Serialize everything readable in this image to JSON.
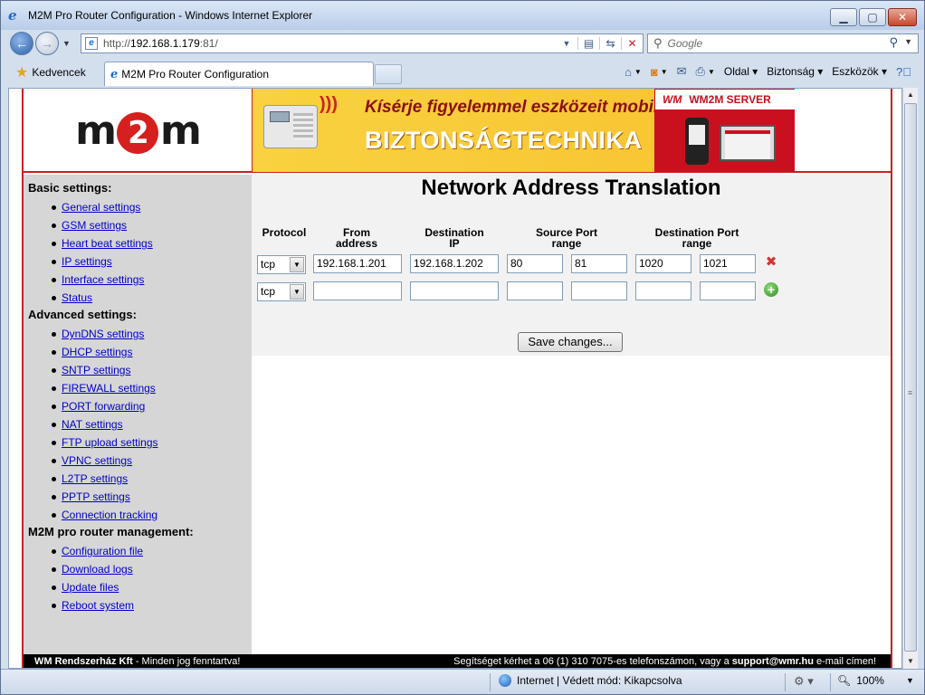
{
  "window": {
    "title": "M2M Pro Router Configuration - Windows Internet Explorer",
    "min_label": "▁",
    "max_label": "▢",
    "close_label": "✕"
  },
  "nav": {
    "url_prefix": "http://",
    "url_host": "192.168.1.179",
    "url_suffix": ":81/",
    "search_placeholder": "Google"
  },
  "favbar": {
    "favorites_label": "Kedvencek",
    "tab_title": "M2M Pro Router Configuration",
    "page_menu": "Oldal",
    "safety_menu": "Biztonság",
    "tools_menu": "Eszközök"
  },
  "banner": {
    "slogan": "Kísérje figyelemmel eszközeit mobilon!",
    "headline": "BIZTONSÁGTECHNIKA",
    "wm_logo": "WM",
    "wm_server": "WM2M SERVER"
  },
  "sidebar": {
    "basic_title": "Basic settings:",
    "basic_items": [
      "General settings",
      "GSM settings",
      "Heart beat settings",
      "IP settings",
      "Interface settings",
      "Status"
    ],
    "advanced_title": "Advanced settings:",
    "advanced_items": [
      "DynDNS settings",
      "DHCP settings",
      "SNTP settings",
      "FIREWALL settings",
      "PORT forwarding",
      "NAT settings",
      "FTP upload settings",
      "VPNC settings",
      "L2TP settings",
      "PPTP settings",
      "Connection tracking"
    ],
    "mgmt_title": "M2M pro router management:",
    "mgmt_items": [
      "Configuration file",
      "Download logs",
      "Update files",
      "Reboot system"
    ]
  },
  "main": {
    "heading": "Network Address Translation",
    "headers": {
      "protocol": "Protocol",
      "from_1": "From",
      "from_2": "address",
      "dest_1": "Destination",
      "dest_2": "IP",
      "sport_1": "Source Port",
      "sport_2": "range",
      "dport_1": "Destination Port",
      "dport_2": "range"
    },
    "rows": [
      {
        "protocol": "tcp",
        "from": "192.168.1.201",
        "dest": "192.168.1.202",
        "sp_from": "80",
        "sp_to": "81",
        "dp_from": "1020",
        "dp_to": "1021"
      },
      {
        "protocol": "tcp",
        "from": "",
        "dest": "",
        "sp_from": "",
        "sp_to": "",
        "dp_from": "",
        "dp_to": ""
      }
    ],
    "save_label": "Save changes..."
  },
  "footer": {
    "company": "WM Rendszerház Kft",
    "rights": " - Minden jog fenntartva!",
    "help_text": "Segítséget kérhet a 06 (1) 310 7075-es telefonszámon, vagy a ",
    "email": "support@wmr.hu",
    "help_tail": " e-mail címen!"
  },
  "status": {
    "zone": "Internet | Védett mód: Kikapcsolva",
    "zoom": "100%"
  }
}
